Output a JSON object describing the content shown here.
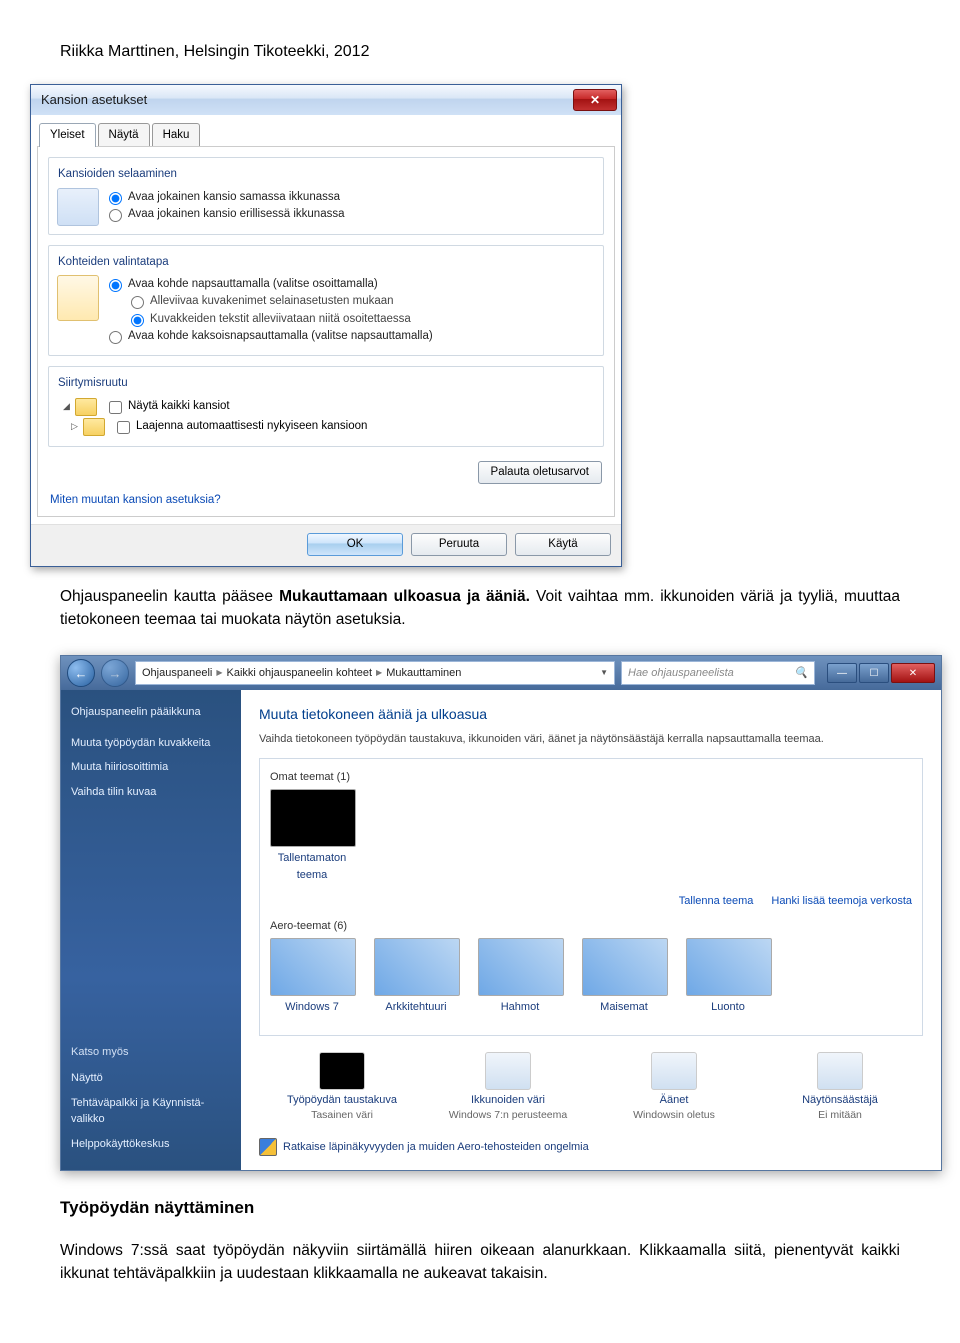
{
  "doc_header": "Riikka Marttinen, Helsingin Tikoteekki, 2012",
  "dlg1": {
    "title": "Kansion asetukset",
    "tabs": [
      "Yleiset",
      "Näytä",
      "Haku"
    ],
    "section1_legend": "Kansioiden selaaminen",
    "section1_opt1": "Avaa jokainen kansio samassa ikkunassa",
    "section1_opt2": "Avaa jokainen kansio erillisessä ikkunassa",
    "section2_legend": "Kohteiden valintatapa",
    "section2_opt1": "Avaa kohde napsauttamalla (valitse osoittamalla)",
    "section2_opt1a": "Alleviivaa kuvakenimet selainasetusten mukaan",
    "section2_opt1b": "Kuvakkeiden tekstit alleviivataan niitä osoitettaessa",
    "section2_opt2": "Avaa kohde kaksoisnapsauttamalla (valitse napsauttamalla)",
    "section3_legend": "Siirtymisruutu",
    "section3_chk1": "Näytä kaikki kansiot",
    "section3_chk2": "Laajenna automaattisesti nykyiseen kansioon",
    "reset_btn": "Palauta oletusarvot",
    "help_link": "Miten muutan kansion asetuksia?",
    "ok_btn": "OK",
    "cancel_btn": "Peruuta",
    "apply_btn": "Käytä"
  },
  "mid_para_prefix": "Ohjauspaneelin kautta pääsee ",
  "mid_para_bold": "Mukauttamaan ulkoasua ja ääniä.",
  "mid_para_suffix": " Voit vaihtaa mm. ikkunoiden väriä ja tyyliä, muuttaa tietokoneen teemaa tai muokata näytön asetuksia.",
  "win2": {
    "breadcrumb": [
      "Ohjauspaneeli",
      "Kaikki ohjauspaneelin kohteet",
      "Mukauttaminen"
    ],
    "search_placeholder": "Hae ohjauspaneelista",
    "side_title": "Ohjauspaneelin pääikkuna",
    "side_links": [
      "Muuta työpöydän kuvakkeita",
      "Muuta hiiriosoittimia",
      "Vaihda tilin kuvaa"
    ],
    "see_also_head": "Katso myös",
    "see_also_links": [
      "Näyttö",
      "Tehtäväpalkki ja Käynnistä-valikko",
      "Helppokäyttökeskus"
    ],
    "main_title": "Muuta tietokoneen ääniä ja ulkoasua",
    "main_desc": "Vaihda tietokoneen työpöydän taustakuva, ikkunoiden väri, äänet ja näytönsäästäjä kerralla napsauttamalla teemaa.",
    "own_themes_head": "Omat teemat (1)",
    "own_theme_label": "Tallentamaton teema",
    "save_theme": "Tallenna teema",
    "get_more": "Hanki lisää teemoja verkosta",
    "aero_head": "Aero-teemat (6)",
    "aero_items": [
      "Windows 7",
      "Arkkitehtuuri",
      "Hahmot",
      "Maisemat",
      "Luonto"
    ],
    "bottom": [
      {
        "title": "Työpöydän taustakuva",
        "sub": "Tasainen väri"
      },
      {
        "title": "Ikkunoiden väri",
        "sub": "Windows 7:n perusteema"
      },
      {
        "title": "Äänet",
        "sub": "Windowsin oletus"
      },
      {
        "title": "Näytönsäästäjä",
        "sub": "Ei mitään"
      }
    ],
    "troubleshoot": "Ratkaise läpinäkyvyyden ja muiden Aero-tehosteiden ongelmia"
  },
  "section_heading": "Työpöydän näyttäminen",
  "last_para": "Windows 7:ssä saat työpöydän näkyviin siirtämällä hiiren oikeaan alanurkkaan. Klikkaamalla siitä, pienentyvät kaikki ikkunat tehtäväpalkkiin ja uudestaan klikkaamalla ne aukeavat takaisin."
}
